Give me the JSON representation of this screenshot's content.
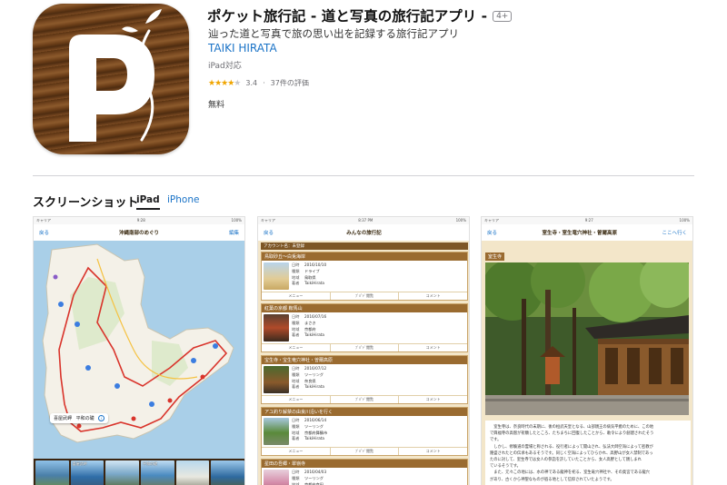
{
  "app": {
    "title": "ポケット旅行記 - 道と写真の旅行記アプリ -",
    "age_rating": "4+",
    "subtitle": "辿った道と写真で旅の思い出を記録する旅行記アプリ",
    "developer": "TAIKI HIRATA",
    "device_support": "iPad対応",
    "rating_value": "3.4",
    "rating_count": "37件の評価",
    "rating_stars": 3.4,
    "price": "無料",
    "icon_colors": {
      "wood_dark": "#5a3312",
      "wood_light": "#8c5a2c",
      "letter": "#ffffff"
    }
  },
  "screenshots": {
    "heading": "スクリーンショット",
    "tabs": [
      {
        "label": "iPad",
        "selected": true
      },
      {
        "label": "iPhone",
        "selected": false
      }
    ],
    "shot1": {
      "status_left": "キャリア",
      "status_center": "9:28",
      "status_right": "100%",
      "back": "戻る",
      "title": "沖縄南部のめぐり",
      "action": "編集",
      "callout_label": "喜屋武岬",
      "callout_sub": "平和の礎",
      "thumb_labels": [
        "",
        "喜屋武岬",
        "",
        "平和の礎",
        "",
        ""
      ]
    },
    "shot2": {
      "status_left": "キャリア",
      "status_center": "8:37 PM",
      "status_right": "100%",
      "back": "戻る",
      "title": "みんなの旅行記",
      "account": "アカウント名：未登録",
      "field_keys": [
        "日時",
        "種類",
        "地域",
        "著者"
      ],
      "actions": [
        "メニュー",
        "ﾌﾞﾊﾟﾄﾞ閲覧",
        "コメント"
      ],
      "cards": [
        {
          "title": "鳥取砂丘～白兎海岸",
          "date": "2016/10/10",
          "type": "ドライブ",
          "region": "鳥取県",
          "author": "TaikiHirata"
        },
        {
          "title": "紅葉の京都 鞍馬山",
          "date": "2016/07/16",
          "type": "まさき",
          "region": "京都府",
          "author": "TaikiHirata"
        },
        {
          "title": "宝生寺・宝生竜穴神社・曽爾高原",
          "date": "2016/07/12",
          "type": "ツーリング",
          "region": "奈良県",
          "author": "TaikiHirata"
        },
        {
          "title": "アユ釣り解禁の由良川沿いを行く",
          "date": "2016/06/14",
          "type": "ツーリング",
          "region": "京都府舞鶴市",
          "author": "TaikiHirata"
        },
        {
          "title": "星田の吾郷・翠嶺寺",
          "date": "2016/04/03",
          "type": "ツーリング",
          "region": "京都府京田",
          "author": "TaikiHirata"
        }
      ]
    },
    "shot3": {
      "status_left": "キャリア",
      "status_center": "9:27",
      "status_right": "100%",
      "back": "戻る",
      "title": "室生寺・室生竜穴神社・曽爾高原",
      "action": "ここへ行く",
      "place": "室生寺",
      "text_lines": [
        "　室生寺は、奈良時代の末期に、後の桓武天皇となる、山部親王の病気平癒のために、この地",
        "で興福寺の高僧が祈願したところ、たちまちに回復したことから、勅令により創建されたそう",
        "です。",
        "　しかし、修験道の霊場と称される、役行者によって開山され、弘法大師空海によって密教が",
        "隆盛されたとの伝承もあるそうです。同じく空海によってひらかれ、高野山が女人禁制であっ",
        "たのに対して、室生寺では女人の参詣を許していたことから、女人高野として親しまれ",
        "ているそうです。",
        "　また、元々この地には、水の神である龍神を祀る、室生竜穴神社や、その奥宮である龍穴",
        "があり、古くから神聖なものが宿る地として信仰されていたようです。"
      ]
    }
  },
  "colors": {
    "link": "#1a73c7",
    "star": "#f0a500",
    "card_header": "#9a6b30",
    "card_bg": "#f3e6c9"
  }
}
